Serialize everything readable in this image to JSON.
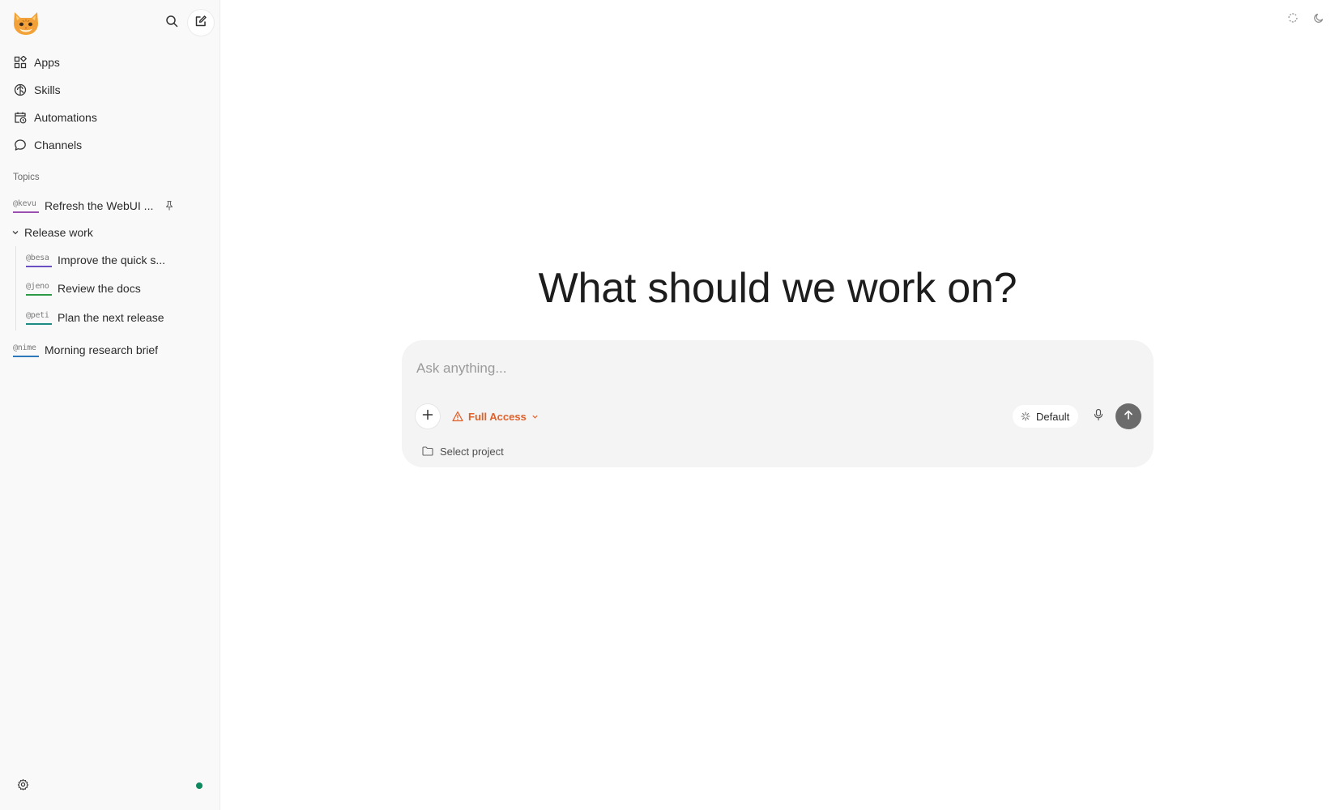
{
  "app": {
    "logo_icon": "cat-face-logo"
  },
  "sidebar": {
    "search_icon": "search-icon",
    "compose_icon": "new-chat-icon",
    "nav": [
      {
        "label": "Apps",
        "icon": "apps-grid-icon"
      },
      {
        "label": "Skills",
        "icon": "brain-icon"
      },
      {
        "label": "Automations",
        "icon": "calendar-clock-icon"
      },
      {
        "label": "Channels",
        "icon": "chat-bubble-icon"
      }
    ],
    "topics_label": "Topics",
    "topics": [
      {
        "handle": "@kevu",
        "title": "Refresh the WebUI ...",
        "color": "#9b4fb0",
        "pinned": true
      },
      {
        "group": "Release work",
        "expanded": true,
        "items": [
          {
            "handle": "@besa",
            "title": "Improve the quick s...",
            "color": "#6a4fc4"
          },
          {
            "handle": "@jeno",
            "title": "Review the docs",
            "color": "#2f9a46"
          },
          {
            "handle": "@peti",
            "title": "Plan the next release",
            "color": "#1e8c82"
          }
        ]
      },
      {
        "handle": "@nime",
        "title": "Morning research brief",
        "color": "#2b79b8"
      }
    ],
    "settings_icon": "gear-icon",
    "status_color": "#0f8a5f"
  },
  "main": {
    "headline": "What should we work on?",
    "composer": {
      "placeholder": "Ask anything...",
      "access_label": "Full Access",
      "access_color": "#e0612a",
      "model_label": "Default",
      "project_label": "Select project"
    }
  }
}
